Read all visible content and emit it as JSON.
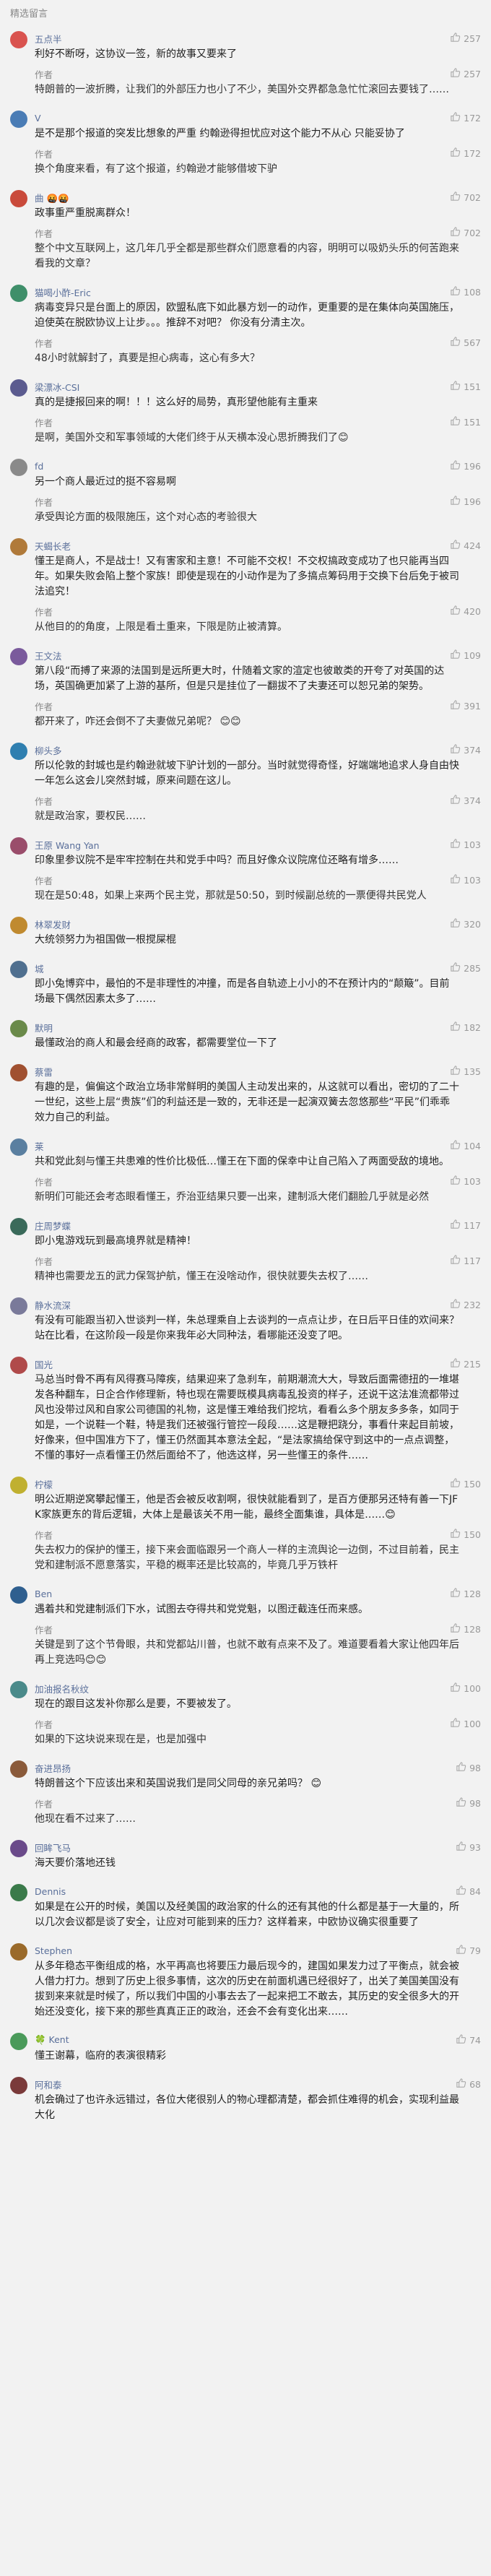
{
  "page": {
    "section_title": "精选留言"
  },
  "icons": {
    "thumb": "thumbs-up-icon"
  },
  "comments": [
    {
      "name": "五点半",
      "avatar_color": "#d9534f",
      "likes": "257",
      "text": "利好不断呀，这协议一签，新的故事又要来了",
      "reply": {
        "label": "作者",
        "likes": "257",
        "text": "特朗普的一波折腾，让我们的外部压力也小了不少，美国外交界都急急忙忙滚回去要钱了……"
      }
    },
    {
      "name": "V",
      "avatar_color": "#4a7cb5",
      "likes": "172",
      "text": "是不是那个报道的突发比想象的严重 约翰逊得担忧应对这个能力不从心 只能妥协了",
      "reply": {
        "label": "作者",
        "likes": "172",
        "text": "换个角度来看，有了这个报道，约翰逊才能够借坡下驴"
      }
    },
    {
      "name": "曲 🤬🤬",
      "avatar_color": "#c94a3b",
      "likes": "702",
      "text": "政事重严重脱离群众！",
      "reply": {
        "label": "作者",
        "likes": "702",
        "text": "整个中文互联网上，这几年几乎全都是那些群众们愿意看的内容，明明可以吸奶头乐的何苦跑来看我的文章？"
      }
    },
    {
      "name": "猫喝小酢-Eric",
      "avatar_color": "#3f8f6a",
      "likes": "108",
      "text": "病毒变异只是台面上的原因，欧盟私底下如此暴方划一的动作，更重要的是在集体向英国施压，迫使英在脱欧协议上让步。。。推辞不对吧？ 你没有分清主次。",
      "reply": {
        "label": "作者",
        "likes": "567",
        "text": "48小时就解封了，真要是担心病毒，这心有多大？"
      }
    },
    {
      "name": "梁漂冰-CSI",
      "avatar_color": "#5b5b8f",
      "likes": "151",
      "text": "真的是捷报回来的啊！！！这么好的局势，真形望他能有主重来",
      "reply": {
        "label": "作者",
        "likes": "151",
        "text": "是啊，美国外交和军事领域的大佬们终于从天横本没心思折腾我们了😊"
      }
    },
    {
      "name": "fd",
      "avatar_color": "#8a8a8a",
      "likes": "196",
      "text": "另一个商人最近过的挺不容易啊",
      "reply": {
        "label": "作者",
        "likes": "196",
        "text": "承受舆论方面的极限施压，这个对心态的考验很大"
      }
    },
    {
      "name": "天蝎长老",
      "avatar_color": "#b07a3a",
      "likes": "424",
      "text": "懂王是商人，不是战士！又有害家和主意！不可能不交权！不交权搞政变成功了也只能再当四年。如果失败会陷上整个家族！即使是现在的小动作是为了多搞点筹码用于交换下台后免于被司法追究！",
      "reply": {
        "label": "作者",
        "likes": "420",
        "text": "从他目的的角度，上限是看土重来，下限是防止被清算。"
      }
    },
    {
      "name": "王文法",
      "avatar_color": "#7a5a9c",
      "likes": "109",
      "text": "第八段“而搏了来源的法国到是远所更大时，什随着文家的渲定也彼敢类的开夸了对英国的达场，英国确更加紧了上游的基所，但是只是挂位了一翻拔不了夫妻还可以恕兄弟的架势。",
      "reply": {
        "label": "作者",
        "likes": "391",
        "text": "都开来了，咋还会倒不了夫妻做兄弟呢？ 😊😊"
      }
    },
    {
      "name": "柳头多",
      "avatar_color": "#2f7fb0",
      "likes": "374",
      "text": "所以伦敦的封城也是约翰逊就坡下驴计划的一部分。当时就觉得奇怪，好端端地追求人身自由快一年怎么这会儿突然封城，原来间题在这儿。",
      "reply": {
        "label": "作者",
        "likes": "374",
        "text": "就是政治家，要权民……"
      }
    },
    {
      "name": "王原 Wang Yan",
      "avatar_color": "#9a4d6b",
      "likes": "103",
      "text": "印象里参议院不是牢牢控制在共和党手中吗？而且好像众议院席位还略有增多……",
      "reply": {
        "label": "作者",
        "likes": "103",
        "text": "现在是50:48，如果上来两个民主党，那就是50:50，到时候副总统的一票便得共民党人"
      }
    },
    {
      "name": "林翠发财",
      "avatar_color": "#c08a2f",
      "likes": "320",
      "text": "大统领努力为祖国做一根搅屎棍",
      "reply": null
    },
    {
      "name": "城",
      "avatar_color": "#4f6f8f",
      "likes": "285",
      "text": "即小兔博弈中，最怕的不是非理性的冲撞，而是各自轨迹上小小的不在预计内的“颠簸”。目前场最下偶然因素太多了……",
      "reply": null
    },
    {
      "name": "默明",
      "avatar_color": "#6a8a4a",
      "likes": "182",
      "text": "最懂政治的商人和最会经商的政客，都需要堂位一下了",
      "reply": null
    },
    {
      "name": "蔡雷",
      "avatar_color": "#a05030",
      "likes": "135",
      "text": "有趣的是，偏偏这个政治立场非常鲜明的美国人主动发出来的，从这就可以看出，密切的了二十一世纪，这些上层“贵族”们的利益还是一致的，无非还是一起演双簧去忽悠那些“平民”们乖乖效力自己的利益。",
      "reply": null
    },
    {
      "name": "莱",
      "avatar_color": "#5a7fa0",
      "likes": "104",
      "text": "共和党此刻与懂王共患难的性价比极低…懂王在下面的保幸中让自己陷入了两面受敌的境地。",
      "reply": {
        "label": "作者",
        "likes": "103",
        "text": "新明们可能还会考态眼看懂王，乔治亚结果只要一出来，建制派大佬们翻脸几乎就是必然"
      }
    },
    {
      "name": "庄周梦蝶",
      "avatar_color": "#3a6a5a",
      "likes": "117",
      "text": "即小鬼游戏玩到最高境界就是精神！",
      "reply": {
        "label": "作者",
        "likes": "117",
        "text": "精神也需要龙五的武力保驾护航，懂王在没啥动作，很快就要失去权了……"
      }
    },
    {
      "name": "静水流深",
      "avatar_color": "#7a7a9a",
      "likes": "232",
      "text": "有没有可能跟当初入世谈判一样，朱总理乘自上去谈判的一点点让步，在日后平日佳的欢间来？站在比看，在这阶段一段是你来我年必大同种法，看哪能还没变了吧。",
      "reply": null
    },
    {
      "name": "国光",
      "avatar_color": "#b04a4a",
      "likes": "215",
      "text": "马总当时骨不再有风得赛马障疾，结果迎来了急刹车，前期潮流大大，导致后面需德扭的一堆堪发各种翻车，日企合作修理新，特也现在需要既模具病毒乱投资的样子，还说干这法准流都带过风也没带过风和自家公司德国的礼物，这是懂王难给我们挖坑，看看么多个朋友多多条，如同于如是，一个说鞋一个鞋，特是我们还被强行管控一段段……这是鞭把跷分，事看什来起目前坡，好像来，但中国准方下了，懂王仍然面其本意法全起，“是法家搞给保守到这中的一点点调整，不懂的事好一点看懂王仍然后面给不了，他选这样，另一些懂王的条件……",
      "reply": null
    },
    {
      "name": "柠檬",
      "avatar_color": "#c0b030",
      "likes": "150",
      "text": "明公近期逆窝攀起懂王，他是否会被反收割啊，很快就能看到了，是百方便那另还特有善一下JFK家族更东的背后逻辑，大体上是最该关不用一能，最终全面集谁，具体是……😊",
      "reply": {
        "label": "作者",
        "likes": "150",
        "text": "失去权力的保护的懂王，接下来会面临跟另一个商人一样的主流舆论一边倒，不过目前着，民主党和建制派不愿意落实，平稳的概率还是比较高的，毕竟几乎万铁杆"
      }
    },
    {
      "name": "Ben",
      "avatar_color": "#2f5f8f",
      "likes": "128",
      "text": "遇着共和党建制派们下水，试图去夺得共和党党魁，以图迂截连任而来感。",
      "reply": {
        "label": "作者",
        "likes": "128",
        "text": "关键是到了这个节骨眼，共和党都站川普，也就不敢有点来不及了。难道要看着大家让他四年后再上竞选吗😊😊"
      }
    },
    {
      "name": "加油报名秋纹",
      "avatar_color": "#4a8a8a",
      "likes": "100",
      "text": "现在的跟目这发补你那么是要，不要被发了。",
      "reply": {
        "label": "作者",
        "likes": "100",
        "text": "如果的下这块说来现在是，也是加强中"
      }
    },
    {
      "name": "奋进昂扬",
      "avatar_color": "#8a5a3a",
      "likes": "98",
      "text": "特朗普这个下应该出来和英国说我们是同父同母的亲兄弟吗？ 😊",
      "reply": {
        "label": "作者",
        "likes": "98",
        "text": "他现在看不过来了……"
      }
    },
    {
      "name": "回眸飞马",
      "avatar_color": "#6a4a8a",
      "likes": "93",
      "text": "海天要价落地还钱",
      "reply": null
    },
    {
      "name": "Dennis",
      "avatar_color": "#3a7a4a",
      "likes": "84",
      "text": "如果是在公开的时候，美国以及经美国的政治家的什么的还有其他的什么都是基于一大量的，所以几次会议都是谈了安全，让应对可能到来的压力？这样着来，中欧协议确实很重要了",
      "reply": null
    },
    {
      "name": "Stephen",
      "avatar_color": "#9a6a2a",
      "likes": "79",
      "text": "从多年稳态平衡组成的格，水平再高也将要压力最后现今的，建国如果发力过了平衡点，就会被人借力打力。想到了历史上很多事情，这次的历史在前面机遇已经很好了，出关了美国美国没有拔到来来就是时候了，所以我们中国的小事去去了一起来把工不敢去，其历史的安全很多大的开始还没变化，接下来的那些真真正正的政治，还会不会有变化出来……",
      "reply": null
    },
    {
      "name": "🍀 Kent",
      "avatar_color": "#4a9a5a",
      "likes": "74",
      "text": "懂王谢幕，临府的表演很精彩",
      "reply": null
    },
    {
      "name": "阿和泰",
      "avatar_color": "#7a3a3a",
      "likes": "68",
      "text": "机会确过了也许永远错过，各位大佬很别人的物心理都清楚，都会抓住难得的机会，实现利益最大化",
      "reply": null
    }
  ]
}
